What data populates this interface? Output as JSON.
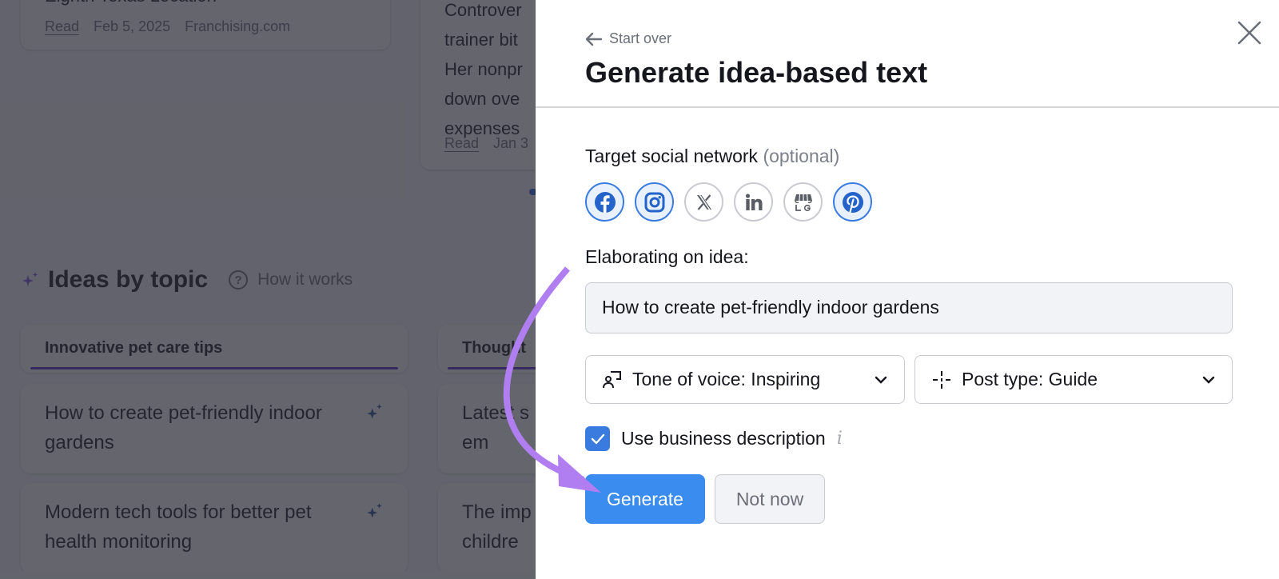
{
  "background": {
    "news_cards": [
      {
        "title_lines": [
          "Eighth Texas Location"
        ],
        "read_label": "Read",
        "date": "Feb 5, 2025",
        "source": "Franchising.com"
      },
      {
        "title_lines": [
          "Controver",
          "trainer bit",
          "Her nonpr",
          "down ove",
          "expenses"
        ],
        "read_label": "Read",
        "date": "Jan 3"
      }
    ],
    "section_title": "Ideas by topic",
    "how_it_works": "How it works",
    "topics": [
      {
        "label": "Innovative pet care tips"
      },
      {
        "label": "Thought"
      }
    ],
    "ideas": [
      {
        "text": "How to create pet-friendly indoor gardens"
      },
      {
        "text": "Modern tech tools for better pet health monitoring"
      },
      {
        "text": "Latest s pet em"
      },
      {
        "text": "The imp childre"
      }
    ]
  },
  "modal": {
    "start_over": "Start over",
    "title": "Generate idea-based text",
    "social_label": "Target social network",
    "social_optional": "(optional)",
    "social_networks": [
      {
        "name": "Facebook",
        "icon": "facebook-icon",
        "selected": true
      },
      {
        "name": "Instagram",
        "icon": "instagram-icon",
        "selected": true
      },
      {
        "name": "X",
        "icon": "x-icon",
        "selected": false
      },
      {
        "name": "LinkedIn",
        "icon": "linkedin-icon",
        "selected": false
      },
      {
        "name": "Google Business Profile",
        "icon": "google-business-icon",
        "selected": false
      },
      {
        "name": "Pinterest",
        "icon": "pinterest-icon",
        "selected": true
      }
    ],
    "idea_label": "Elaborating on idea:",
    "idea_value": "How to create pet-friendly indoor gardens",
    "tone_select": "Tone of voice: Inspiring",
    "post_type_select": "Post type: Guide",
    "use_business_description": "Use business description",
    "use_business_checked": true,
    "info_glyph": "i",
    "generate_label": "Generate",
    "not_now_label": "Not now"
  },
  "colors": {
    "primary_blue": "#3a8cee",
    "selected_border": "#3a7be0",
    "accent_purple": "#5b2fc9",
    "annotation_arrow": "#b07ef0"
  }
}
